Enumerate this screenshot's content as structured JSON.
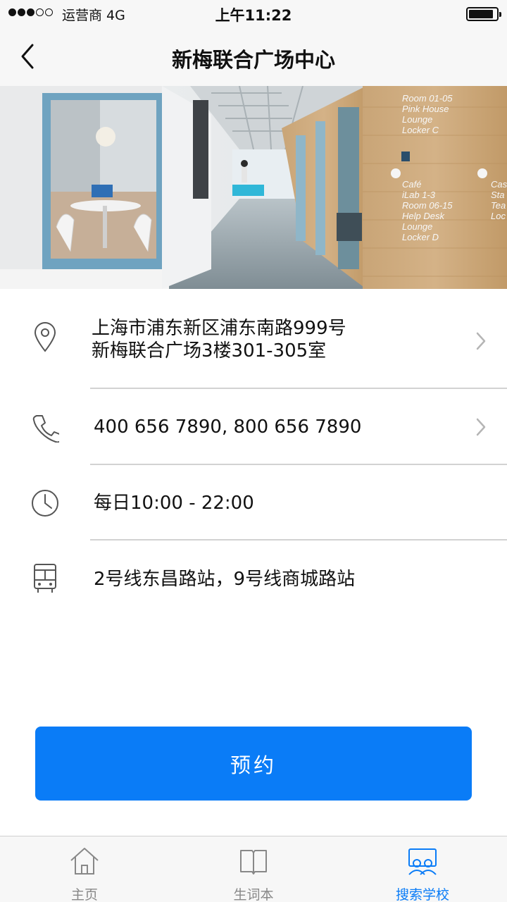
{
  "status_bar": {
    "carrier": "运营商 4G",
    "time": "上午11:22"
  },
  "nav": {
    "title": "新梅联合广场中心"
  },
  "hero": {
    "wall_sign_right": [
      "Room 01-05",
      "Pink House",
      "Lounge",
      "Locker C"
    ],
    "wall_sign_lower": [
      "Café",
      "iLab 1-3",
      "Room 06-15",
      "Help Desk",
      "Lounge",
      "Locker D"
    ],
    "wall_sign_far": [
      "Cas",
      "Sta",
      "Tea",
      "Loc"
    ]
  },
  "details": {
    "address_line1": "上海市浦东新区浦东南路999号",
    "address_line2": "新梅联合广场3楼301-305室",
    "phone": "400 656 7890, 800 656 7890",
    "hours": "每日10:00 - 22:00",
    "transit": "2号线东昌路站，9号线商城路站"
  },
  "actions": {
    "book_label": "预约"
  },
  "tab_bar": {
    "tabs": [
      {
        "label": "主页",
        "icon": "home-icon"
      },
      {
        "label": "生词本",
        "icon": "book-icon"
      },
      {
        "label": "搜索学校",
        "icon": "school-search-icon"
      }
    ],
    "active_index": 2
  },
  "colors": {
    "accent": "#0a7cf7",
    "bar_background": "#f7f7f7",
    "divider": "#d2d2d2",
    "inactive_tab": "#888888"
  }
}
